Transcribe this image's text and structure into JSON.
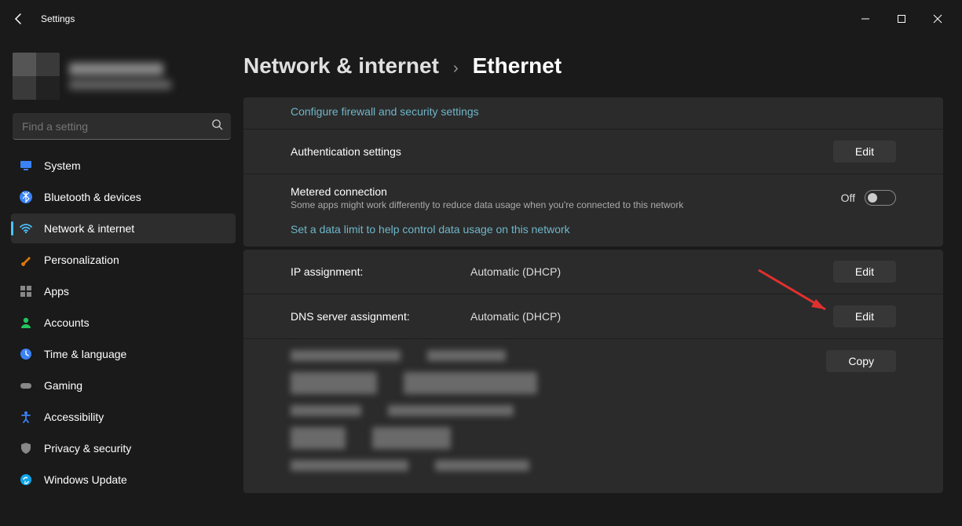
{
  "window": {
    "title": "Settings"
  },
  "search": {
    "placeholder": "Find a setting"
  },
  "sidebar": {
    "items": [
      {
        "label": "System",
        "icon": "display-icon",
        "color": "#3b82f6"
      },
      {
        "label": "Bluetooth & devices",
        "icon": "bluetooth-icon",
        "color": "#3b82f6"
      },
      {
        "label": "Network & internet",
        "icon": "wifi-icon",
        "color": "#3b82f6",
        "active": true
      },
      {
        "label": "Personalization",
        "icon": "paintbrush-icon",
        "color": "#d97706"
      },
      {
        "label": "Apps",
        "icon": "apps-icon",
        "color": "#6b7280"
      },
      {
        "label": "Accounts",
        "icon": "person-icon",
        "color": "#22c55e"
      },
      {
        "label": "Time & language",
        "icon": "clock-icon",
        "color": "#3b82f6"
      },
      {
        "label": "Gaming",
        "icon": "gamepad-icon",
        "color": "#6b7280"
      },
      {
        "label": "Accessibility",
        "icon": "accessibility-icon",
        "color": "#3b82f6"
      },
      {
        "label": "Privacy & security",
        "icon": "shield-icon",
        "color": "#6b7280"
      },
      {
        "label": "Windows Update",
        "icon": "update-icon",
        "color": "#0ea5e9"
      }
    ]
  },
  "breadcrumb": {
    "parent": "Network & internet",
    "current": "Ethernet"
  },
  "links": {
    "firewall": "Configure firewall and security settings",
    "datalimit": "Set a data limit to help control data usage on this network"
  },
  "rows": {
    "auth": {
      "title": "Authentication settings",
      "button": "Edit"
    },
    "metered": {
      "title": "Metered connection",
      "subtitle": "Some apps might work differently to reduce data usage when you're connected to this network",
      "state": "Off"
    },
    "ip": {
      "label": "IP assignment:",
      "value": "Automatic (DHCP)",
      "button": "Edit"
    },
    "dns": {
      "label": "DNS server assignment:",
      "value": "Automatic (DHCP)",
      "button": "Edit"
    },
    "copy": {
      "button": "Copy"
    }
  }
}
